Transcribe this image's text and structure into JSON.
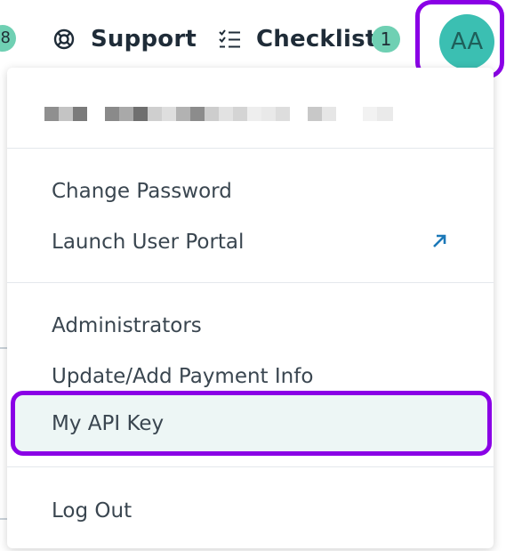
{
  "topbar": {
    "partial_badge": "8",
    "support_label": "Support",
    "checklist_label": "Checklist",
    "checklist_count": "1",
    "avatar_initials": "AA"
  },
  "account_menu": {
    "change_password": "Change Password",
    "launch_user_portal": "Launch User Portal",
    "administrators": "Administrators",
    "update_payment": "Update/Add Payment Info",
    "my_api_key": "My API Key",
    "log_out": "Log Out"
  },
  "colors": {
    "accent_highlight": "#8a00e6",
    "badge": "#6fd0b3",
    "avatar": "#3bbfb2",
    "link_icon": "#1b78b8"
  }
}
